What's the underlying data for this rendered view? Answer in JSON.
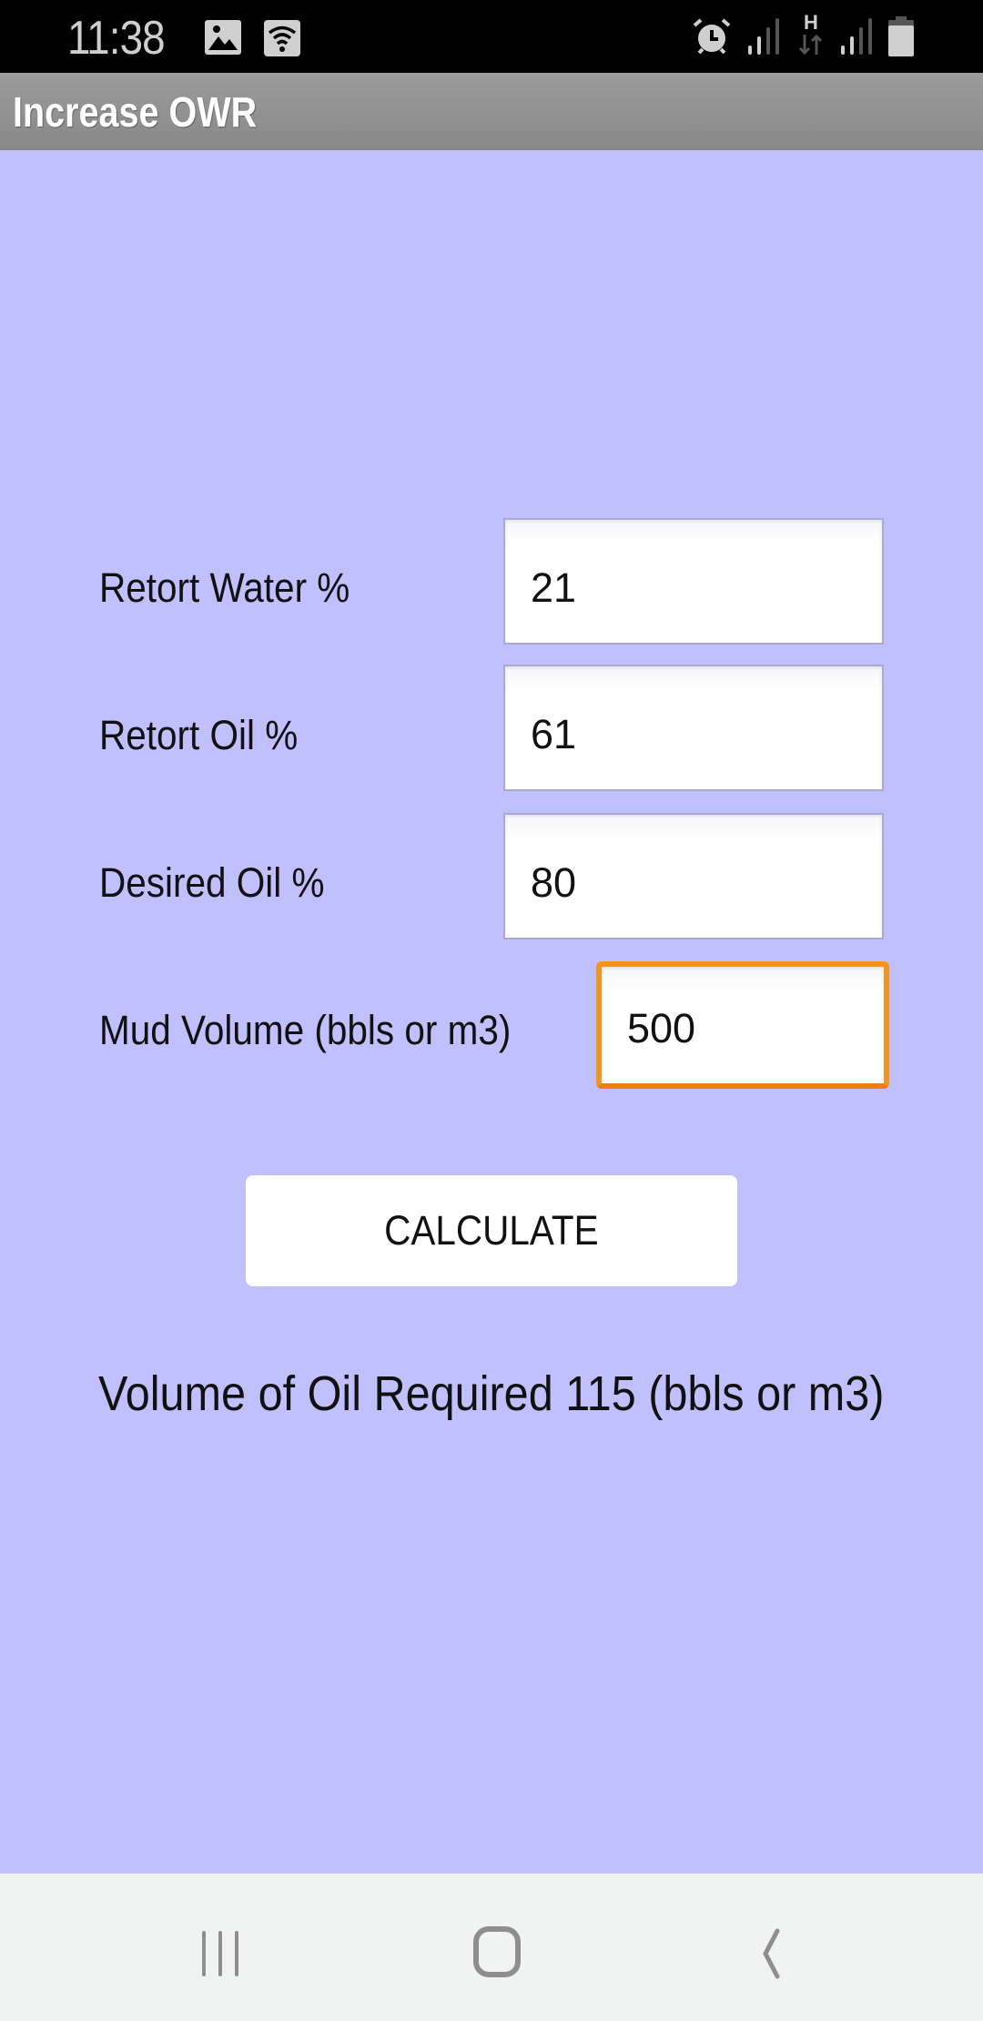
{
  "status_bar": {
    "time": "11:38",
    "left_icons": [
      "gallery-icon",
      "wifi-icon"
    ],
    "right_icons": [
      "alarm-icon",
      "signal-icon",
      "hspa-data-icon",
      "signal-icon",
      "battery-icon"
    ],
    "network_type": "H"
  },
  "app_bar": {
    "title": "Increase OWR"
  },
  "form": {
    "fields": [
      {
        "label": "Retort Water %",
        "value": "21"
      },
      {
        "label": "Retort Oil %",
        "value": "61"
      },
      {
        "label": "Desired Oil %",
        "value": "80"
      },
      {
        "label": "Mud Volume (bbls or m3)",
        "value": "500",
        "focused": true
      }
    ],
    "calculate_label": "CALCULATE"
  },
  "result": {
    "text": "Volume of Oil Required 115 (bbls or m3)"
  },
  "nav_bar": {
    "buttons": [
      "recent-apps",
      "home",
      "back"
    ]
  },
  "colors": {
    "background": "#c0c0ff",
    "focus_border": "#f5931f",
    "app_bar": "#919191"
  }
}
